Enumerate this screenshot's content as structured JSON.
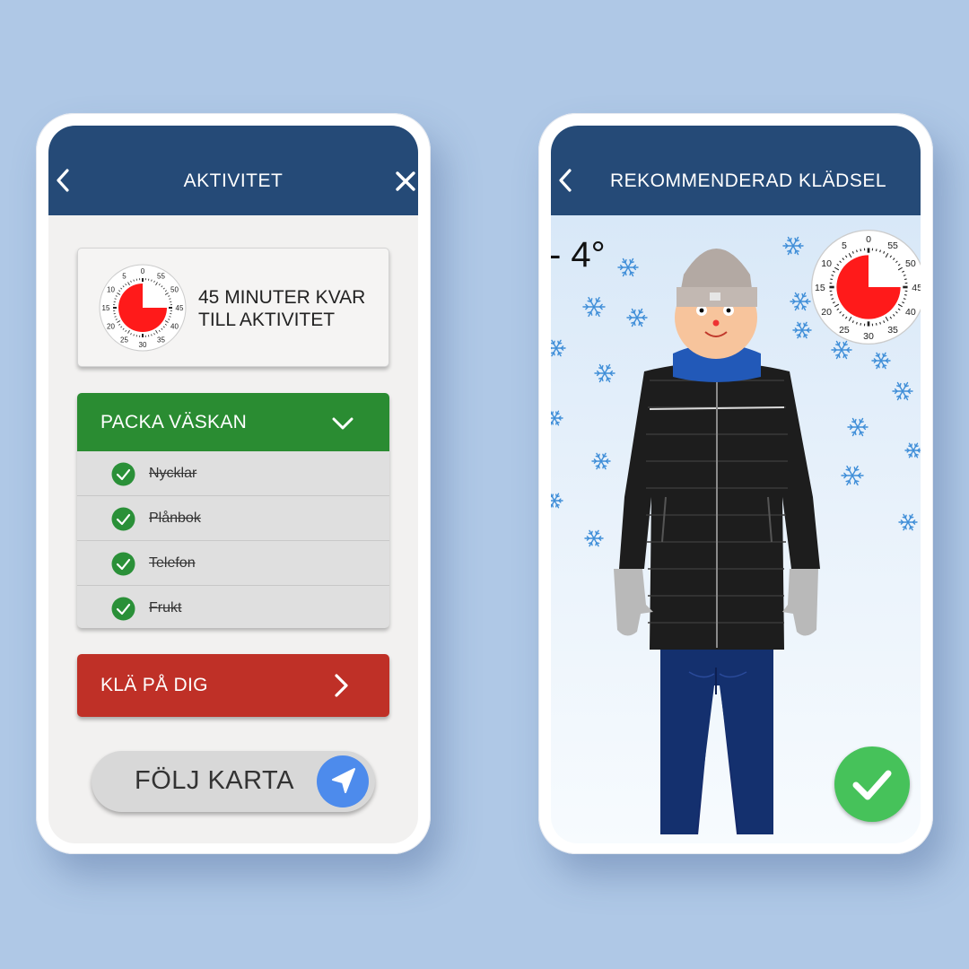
{
  "left_phone": {
    "header": {
      "title": "AKTIVITET",
      "back_icon": "chevron-left-icon",
      "close_icon": "close-icon"
    },
    "timer": {
      "text_line1": "45 MINUTER KVAR",
      "text_line2": "TILL AKTIVITET",
      "minutes_remaining": 45,
      "dial_labels": [
        "0",
        "5",
        "10",
        "15",
        "20",
        "25",
        "30",
        "35",
        "40",
        "45",
        "50",
        "55"
      ]
    },
    "pack": {
      "title": "PACKA VÄSKAN",
      "items": [
        {
          "label": "Nycklar",
          "checked": true
        },
        {
          "label": "Plånbok",
          "checked": true
        },
        {
          "label": "Telefon",
          "checked": true
        },
        {
          "label": "Frukt",
          "checked": true
        }
      ]
    },
    "dress_button": {
      "label": "KLÄ PÅ DIG"
    },
    "map_button": {
      "label": "FÖLJ KARTA",
      "icon": "navigation-arrow-icon"
    }
  },
  "right_phone": {
    "header": {
      "title": "REKOMMENDERAD KLÄDSEL",
      "back_icon": "chevron-left-icon"
    },
    "temperature": "- 4°",
    "timer": {
      "minutes_remaining": 45
    },
    "confirm_icon": "checkmark-icon"
  },
  "colors": {
    "background": "#afc8e6",
    "header": "#254a77",
    "pack_green": "#2a8c32",
    "dress_red": "#bf3027",
    "nav_blue": "#4d8bec",
    "confirm_green": "#46c25a",
    "timer_red": "#ff1a1a"
  }
}
